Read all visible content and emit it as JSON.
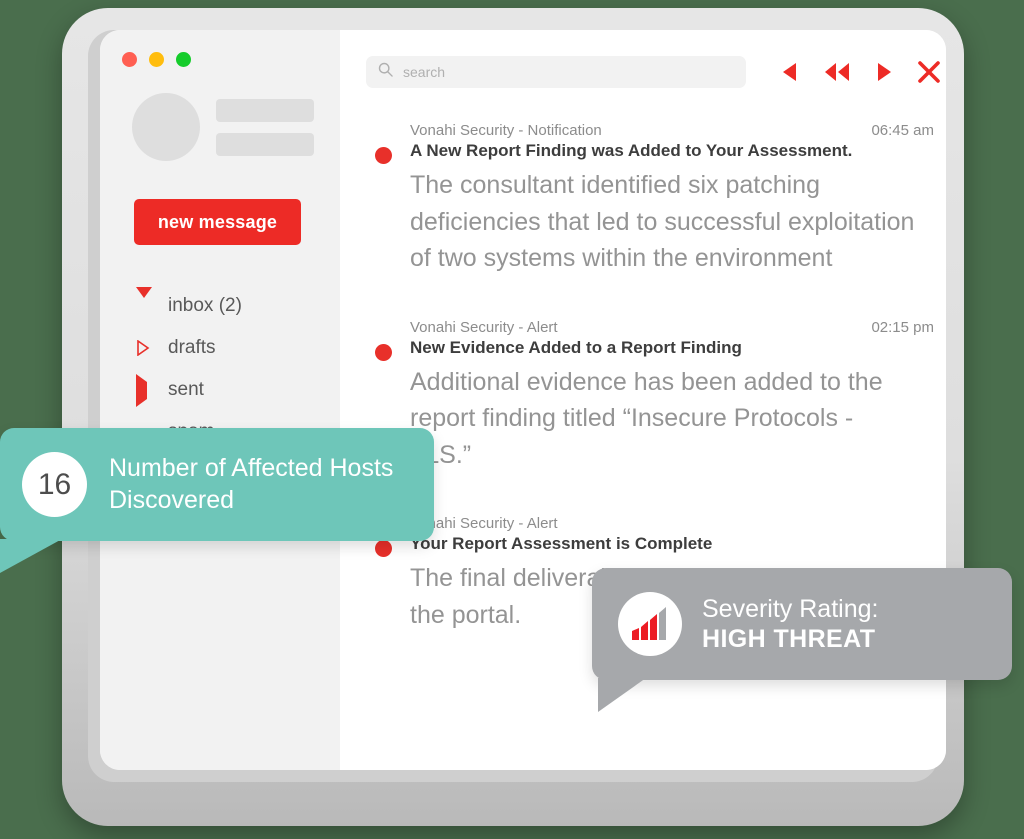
{
  "window_controls": {
    "close_label": "close",
    "minimize_label": "minimize",
    "maximize_label": "maximize"
  },
  "sidebar": {
    "new_message_label": "new message",
    "items": [
      {
        "label": "inbox (2)",
        "icon": "triangle-down-icon",
        "state": "expanded"
      },
      {
        "label": "drafts",
        "icon": "triangle-right-outline-icon",
        "state": "collapsed"
      },
      {
        "label": "sent",
        "icon": "triangle-right-icon",
        "state": "collapsed"
      },
      {
        "label": "spam",
        "icon": "square-icon",
        "state": "collapsed"
      }
    ]
  },
  "toolbar": {
    "search": {
      "placeholder": "search",
      "value": "",
      "icon": "search-icon"
    },
    "controls": [
      {
        "name": "previous-button",
        "icon": "triangle-left-icon"
      },
      {
        "name": "rewind-button",
        "icon": "double-triangle-left-icon"
      },
      {
        "name": "next-button",
        "icon": "triangle-right-icon"
      },
      {
        "name": "close-button",
        "icon": "close-x-icon"
      }
    ]
  },
  "messages": [
    {
      "sender": "Vonahi Security - Notification",
      "time": "06:45 am",
      "subject": "A New Report Finding was Added to Your Assessment.",
      "body": "The consultant identified six patching deficiencies that led to successful exploitation of two systems within the environment",
      "unread": true
    },
    {
      "sender": "Vonahi Security - Alert",
      "time": "02:15 pm",
      "subject": "New Evidence Added to a Report Finding",
      "body": "Additional evidence has been added to the report finding titled “Insecure Protocols - TLS.”",
      "unread": true
    },
    {
      "sender": "Vonahi Security - Alert",
      "time": "",
      "subject": "Your Report Assessment is Complete",
      "body": "The final deliverable has been uploaded to the portal.",
      "unread": true
    }
  ],
  "callouts": {
    "hosts": {
      "count": "16",
      "text": "Number of Affected Hosts Discovered",
      "color": "#6ec6b9"
    },
    "severity": {
      "label": "Severity Rating:",
      "value": "HIGH THREAT",
      "icon": "signal-bars-icon",
      "color": "#a6a8ab"
    }
  },
  "colors": {
    "accent_red": "#ed2b26",
    "unread_dot": "#e8302a",
    "teal": "#6ec6b9",
    "gray": "#a6a8ab",
    "page_background": "#4a6e4d"
  }
}
